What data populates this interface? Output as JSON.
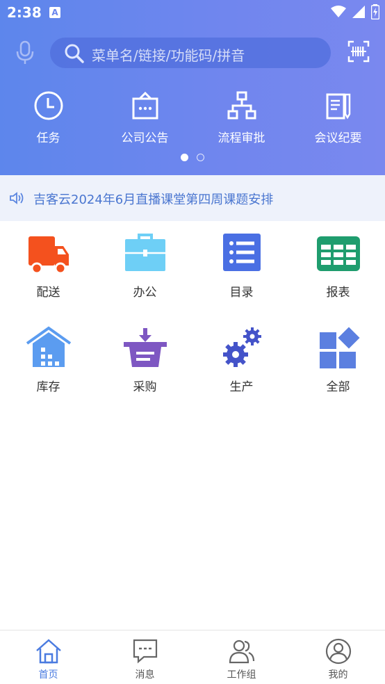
{
  "status_bar": {
    "time": "2:38",
    "notif_glyph": "A"
  },
  "search": {
    "placeholder": "菜单名/链接/功能码/拼音"
  },
  "top_nav": [
    {
      "label": "任务",
      "icon": "clock-icon"
    },
    {
      "label": "公司公告",
      "icon": "announcement-icon"
    },
    {
      "label": "流程审批",
      "icon": "flowchart-icon"
    },
    {
      "label": "会议纪要",
      "icon": "notes-icon"
    }
  ],
  "carousel": {
    "pages": 2,
    "current": 1
  },
  "notice": {
    "text": "吉客云2024年6月直播课堂第四周课题安排"
  },
  "apps": [
    {
      "label": "配送",
      "icon": "truck-icon",
      "color": "#f4511e"
    },
    {
      "label": "办公",
      "icon": "briefcase-icon",
      "color": "#6ecff6"
    },
    {
      "label": "目录",
      "icon": "list-icon",
      "color": "#4a6fe3"
    },
    {
      "label": "报表",
      "icon": "table-icon",
      "color": "#1f9d6e"
    },
    {
      "label": "库存",
      "icon": "warehouse-icon",
      "color": "#5b9cf0"
    },
    {
      "label": "采购",
      "icon": "purchase-basket-icon",
      "color": "#7e57c2"
    },
    {
      "label": "生产",
      "icon": "gears-icon",
      "color": "#4453c9"
    },
    {
      "label": "全部",
      "icon": "all-apps-icon",
      "color": "#5b7fe0"
    }
  ],
  "tabs": [
    {
      "label": "首页",
      "icon": "home-icon",
      "active": true
    },
    {
      "label": "消息",
      "icon": "message-icon",
      "active": false
    },
    {
      "label": "工作组",
      "icon": "group-icon",
      "active": false
    },
    {
      "label": "我的",
      "icon": "profile-icon",
      "active": false
    }
  ],
  "colors": {
    "accent": "#4a7be0",
    "header_start": "#5d86ec",
    "header_end": "#7a88ef"
  }
}
